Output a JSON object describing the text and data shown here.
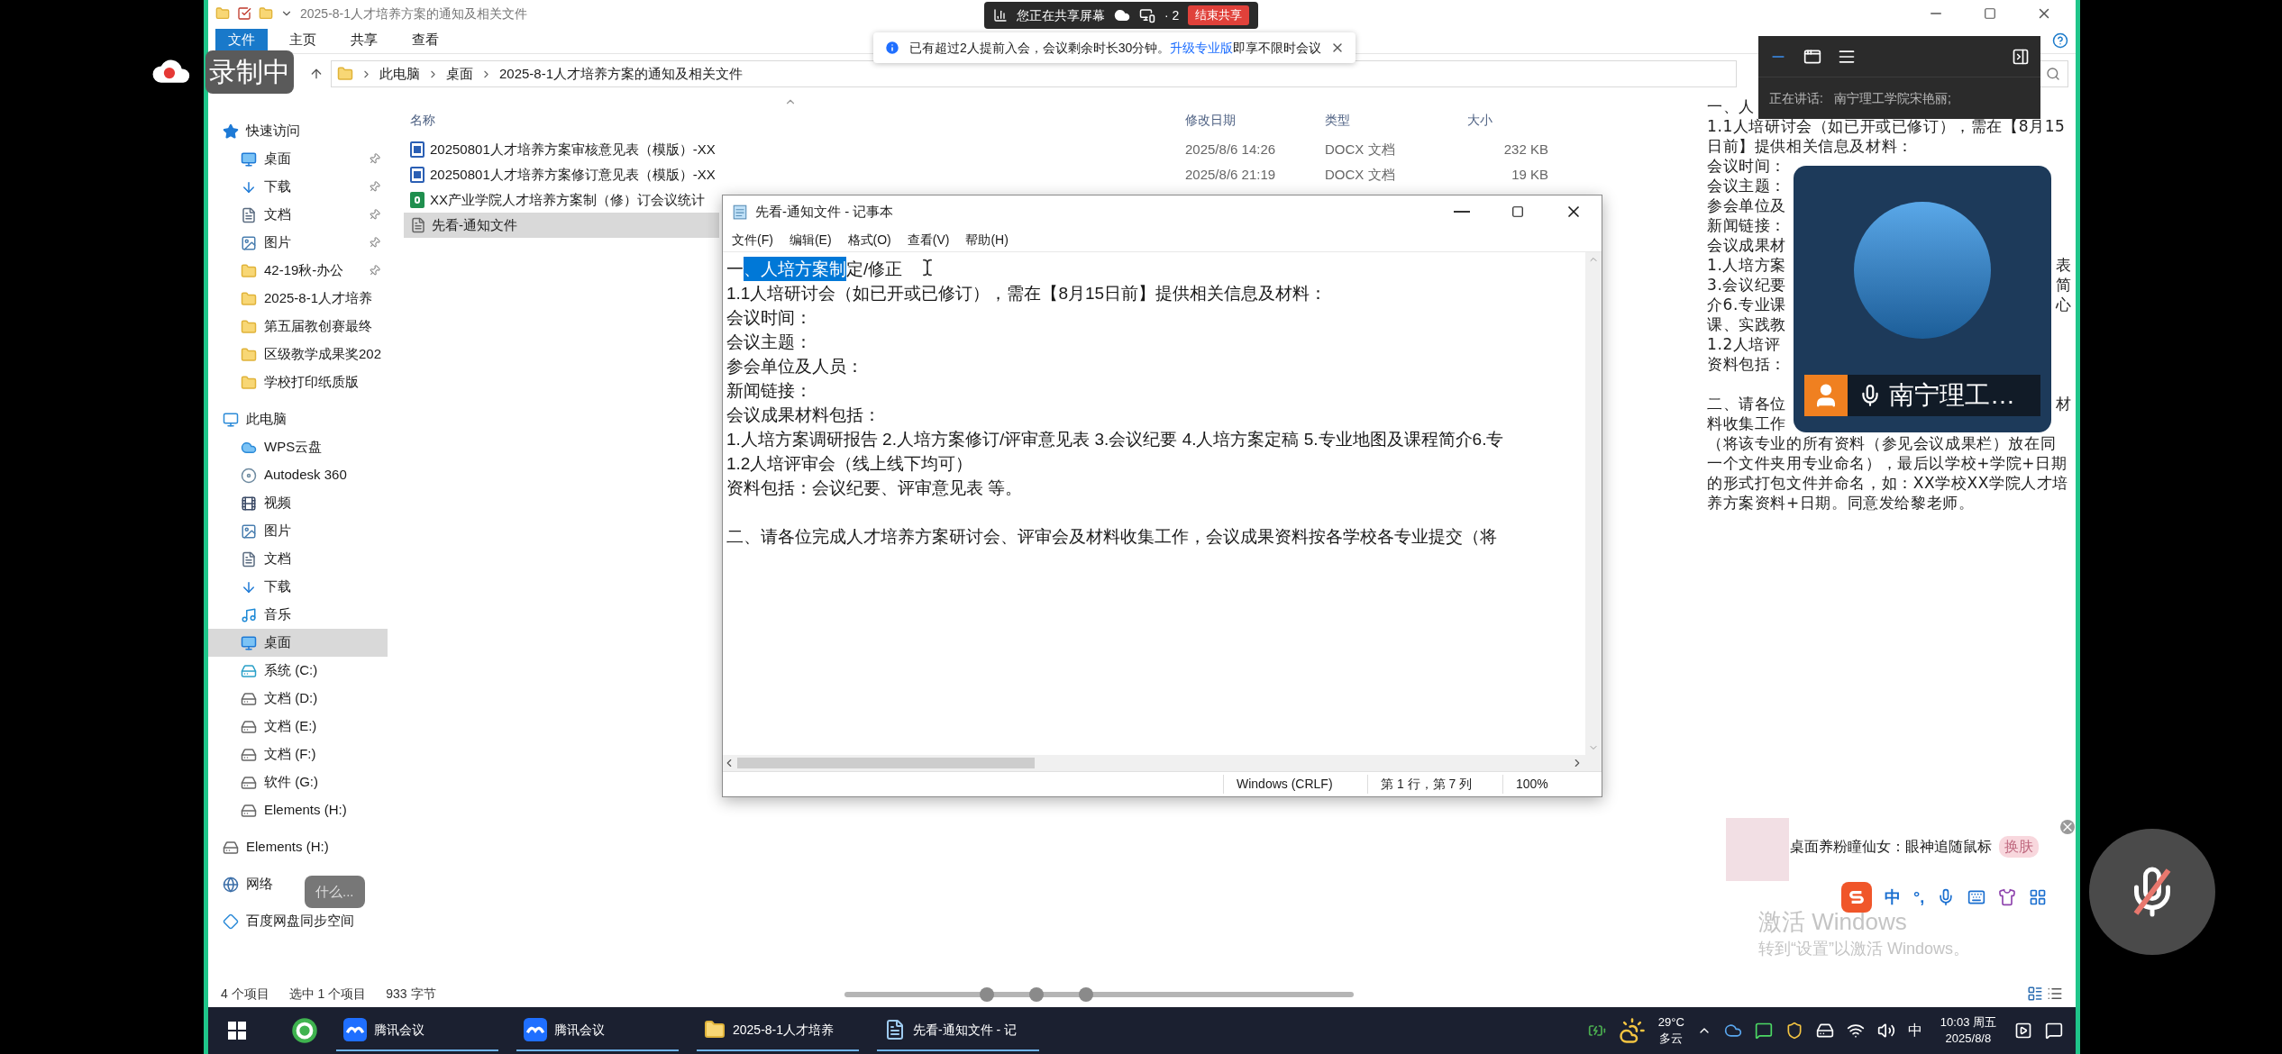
{
  "recording_badge": {
    "label": "录制中"
  },
  "share_bar": {
    "status": "您正在共享屏幕",
    "participants": "· 2",
    "stop_button": "结束共享"
  },
  "notice": {
    "text_before": "已有超过2人提前入会，会议剩余时长30分钟。",
    "link": "升级专业版",
    "text_after": "即享不限时会议"
  },
  "explorer": {
    "title": "2025-8-1人才培养方案的通知及相关文件",
    "ribbon_tabs": [
      {
        "label": "文件",
        "selected": true
      },
      {
        "label": "主页",
        "selected": false
      },
      {
        "label": "共享",
        "selected": false
      },
      {
        "label": "查看",
        "selected": false
      }
    ],
    "breadcrumb": [
      "此电脑",
      "桌面",
      "2025-8-1人才培养方案的通知及相关文件"
    ],
    "sidebar": [
      {
        "kind": "quick-access",
        "label": "快速访问",
        "selected": false,
        "children": [
          {
            "kind": "desktop",
            "label": "桌面",
            "pinned": true,
            "selected": false
          },
          {
            "kind": "download",
            "label": "下载",
            "pinned": true,
            "selected": false
          },
          {
            "kind": "document",
            "label": "文档",
            "pinned": true,
            "selected": false
          },
          {
            "kind": "picture",
            "label": "图片",
            "pinned": true,
            "selected": false
          },
          {
            "kind": "folder",
            "label": "42-19秋-办公",
            "pinned": true,
            "selected": false
          },
          {
            "kind": "folder",
            "label": "2025-8-1人才培养",
            "pinned": false,
            "selected": false
          },
          {
            "kind": "folder",
            "label": "第五届教创赛最终",
            "pinned": false,
            "selected": false
          },
          {
            "kind": "folder",
            "label": "区级教学成果奖202",
            "pinned": false,
            "selected": false
          },
          {
            "kind": "folder",
            "label": "学校打印纸质版",
            "pinned": false,
            "selected": false
          }
        ]
      },
      {
        "kind": "this-pc",
        "label": "此电脑",
        "selected": false,
        "children": [
          {
            "kind": "cloud",
            "label": "WPS云盘",
            "selected": false
          },
          {
            "kind": "autodesk",
            "label": "Autodesk 360",
            "selected": false
          },
          {
            "kind": "video",
            "label": "视频",
            "selected": false
          },
          {
            "kind": "picture",
            "label": "图片",
            "selected": false
          },
          {
            "kind": "document",
            "label": "文档",
            "selected": false
          },
          {
            "kind": "download",
            "label": "下载",
            "selected": false
          },
          {
            "kind": "music",
            "label": "音乐",
            "selected": false
          },
          {
            "kind": "desktop",
            "label": "桌面",
            "selected": true
          },
          {
            "kind": "system-drive",
            "label": "系统 (C:)",
            "selected": false
          },
          {
            "kind": "drive",
            "label": "文档 (D:)",
            "selected": false
          },
          {
            "kind": "drive",
            "label": "文档 (E:)",
            "selected": false
          },
          {
            "kind": "drive",
            "label": "文档 (F:)",
            "selected": false
          },
          {
            "kind": "drive",
            "label": "软件 (G:)",
            "selected": false
          },
          {
            "kind": "drive",
            "label": "Elements (H:)",
            "selected": false
          }
        ]
      },
      {
        "kind": "drive",
        "label": "Elements (H:)",
        "selected": false
      },
      {
        "kind": "network",
        "label": "网络",
        "selected": false
      },
      {
        "kind": "baidu",
        "label": "百度网盘同步空间",
        "selected": false
      }
    ],
    "network_tooltip": "什么...",
    "columns": [
      "名称",
      "修改日期",
      "类型",
      "大小"
    ],
    "files": [
      {
        "kind": "word",
        "name": "20250801人才培养方案审核意见表（模版）-XX",
        "modified": "2025/8/6 14:26",
        "type": "DOCX 文档",
        "size": "232 KB",
        "selected": false
      },
      {
        "kind": "word",
        "name": "20250801人才培养方案修订意见表（模版）-XX",
        "modified": "2025/8/6 21:19",
        "type": "DOCX 文档",
        "size": "19 KB",
        "selected": false
      },
      {
        "kind": "excel",
        "name": "XX产业学院人才培养方案制（修）订会议统计",
        "selected": false
      },
      {
        "kind": "text",
        "name": "先看-通知文件",
        "selected": true
      }
    ],
    "preview": [
      {
        "kind": "text",
        "left": "一、人"
      },
      {
        "kind": "text",
        "left": "1.1人培研讨会（如已开或已修订），需在【8月15"
      },
      {
        "kind": "text",
        "left": "日前】提供相关信息及材料："
      },
      {
        "kind": "text",
        "left": "会议时间："
      },
      {
        "kind": "text",
        "left": "会议主题："
      },
      {
        "kind": "text",
        "left": "参会单位及"
      },
      {
        "kind": "text",
        "left": "新闻链接："
      },
      {
        "kind": "text",
        "left": "会议成果材"
      },
      {
        "kind": "text",
        "left": "1.人培方案",
        "right": "表"
      },
      {
        "kind": "text",
        "left": "3.会议纪要",
        "right": "简"
      },
      {
        "kind": "text",
        "left": "介6.专业课",
        "right": "心"
      },
      {
        "kind": "text",
        "left": "课、实践教"
      },
      {
        "kind": "text",
        "left": "1.2人培评"
      },
      {
        "kind": "text",
        "left": "资料包括："
      },
      {
        "kind": "blank"
      },
      {
        "kind": "text",
        "left": "二、请各位",
        "right": "材"
      },
      {
        "kind": "text",
        "left": "料收集工作"
      },
      {
        "kind": "text",
        "left": "（将该专业的所有资料（参见会议成果栏）放在同"
      },
      {
        "kind": "text",
        "left": "一个文件夹用专业命名），最后以学校+学院+日期"
      },
      {
        "kind": "text",
        "left": "的形式打包文件并命名，如：XX学校XX学院人才培"
      },
      {
        "kind": "text",
        "left": "养方案资料+日期。同意发给黎老师。"
      }
    ],
    "status": [
      "4 个项目",
      "选中 1 个项目",
      "933 字节"
    ]
  },
  "notepad": {
    "title": "先看-通知文件 - 记事本",
    "menu": [
      "文件(F)",
      "编辑(E)",
      "格式(O)",
      "查看(V)",
      "帮助(H)"
    ],
    "lines": [
      {
        "kind": "text",
        "segments": [
          {
            "text": "一",
            "selected": false
          },
          {
            "text": "、人培方案制",
            "selected": true
          },
          {
            "text": "定/修正",
            "selected": false
          }
        ]
      },
      {
        "kind": "text",
        "segments": [
          {
            "text": "1.1人培研讨会（如已开或已修订），需在【8月15日前】提供相关信息及材料：",
            "selected": false
          }
        ]
      },
      {
        "kind": "text",
        "segments": [
          {
            "text": "会议时间：",
            "selected": false
          }
        ]
      },
      {
        "kind": "text",
        "segments": [
          {
            "text": "会议主题：",
            "selected": false
          }
        ]
      },
      {
        "kind": "text",
        "segments": [
          {
            "text": "参会单位及人员：",
            "selected": false
          }
        ]
      },
      {
        "kind": "text",
        "segments": [
          {
            "text": "新闻链接：",
            "selected": false
          }
        ]
      },
      {
        "kind": "text",
        "segments": [
          {
            "text": "会议成果材料包括：",
            "selected": false
          }
        ]
      },
      {
        "kind": "text",
        "segments": [
          {
            "text": "1.人培方案调研报告 2.人培方案修订/评审意见表 3.会议纪要 4.人培方案定稿 5.专业地图及课程简介6.专",
            "selected": false
          }
        ]
      },
      {
        "kind": "text",
        "segments": [
          {
            "text": "1.2人培评审会（线上线下均可）",
            "selected": false
          }
        ]
      },
      {
        "kind": "text",
        "segments": [
          {
            "text": "资料包括：会议纪要、评审意见表 等。",
            "selected": false
          }
        ]
      },
      {
        "kind": "blank"
      },
      {
        "kind": "text",
        "segments": [
          {
            "text": "二、请各位完成人才培养方案研讨会、评审会及材料收集工作，会议成果资料按各学校各专业提交（将",
            "selected": false
          }
        ]
      }
    ],
    "status": {
      "encoding": "Windows (CRLF)",
      "position": "第 1 行，第 7 列",
      "zoom": "100%"
    }
  },
  "meeting_panel": {
    "speaking_label": "正在讲话:",
    "speaker": "南宁理工学院宋艳丽;"
  },
  "video_tile": {
    "name": "南宁理工…"
  },
  "mute_button": {
    "muted": true
  },
  "pet_popup": {
    "text": "桌面养粉瞳仙女：眼神追随鼠标",
    "button": "换肤"
  },
  "ime_bar": {
    "mode": "中",
    "punctuation": "°,"
  },
  "activation": {
    "title": "激活 Windows",
    "hint": "转到“设置”以激活 Windows。"
  },
  "taskbar": {
    "apps": [
      {
        "kind": "browser"
      },
      {
        "kind": "meeting",
        "label": "腾讯会议"
      },
      {
        "kind": "meeting",
        "label": "腾讯会议"
      },
      {
        "kind": "folder",
        "label": "2025-8-1人才培养"
      },
      {
        "kind": "notepad",
        "label": "先看-通知文件 - 记"
      }
    ],
    "weather": {
      "temperature": "29°C",
      "condition": "多云"
    },
    "input_mode": "中",
    "time": "10:03 周五",
    "date": "2025/8/8"
  }
}
